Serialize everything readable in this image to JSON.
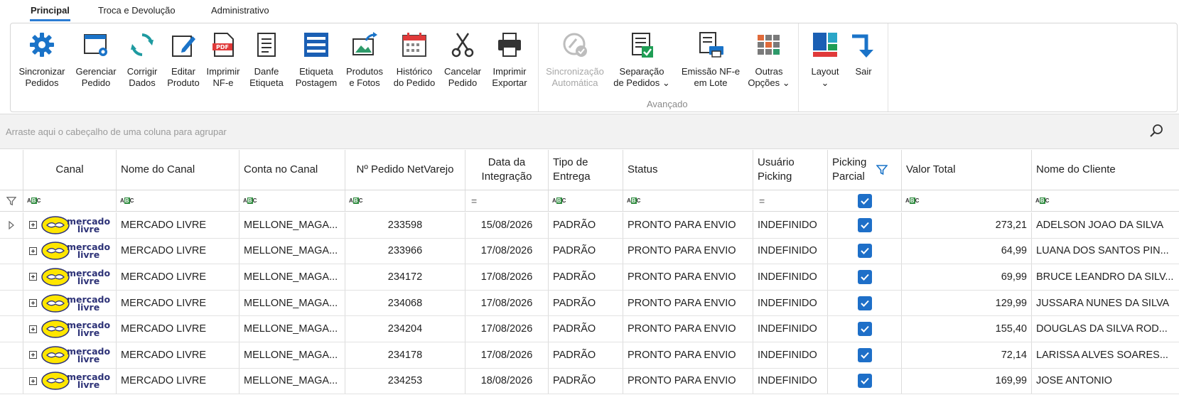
{
  "tabs": [
    {
      "label": "Principal",
      "active": true
    },
    {
      "label": "Troca e Devolução"
    },
    {
      "label": "Administrativo"
    }
  ],
  "ribbon": {
    "buttons": [
      {
        "label": "Sincronizar\nPedidos",
        "icon": "gear-icon"
      },
      {
        "label": "Gerenciar\nPedido",
        "icon": "window-gear-icon"
      },
      {
        "label": "Corrigir\nDados",
        "icon": "refresh-icon"
      },
      {
        "label": "Editar\nProduto",
        "icon": "edit-icon"
      },
      {
        "label": "Imprimir\nNF-e",
        "icon": "pdf-icon"
      },
      {
        "label": "Danfe\nEtiqueta",
        "icon": "document-icon"
      },
      {
        "label": "Etiqueta\nPostagem",
        "icon": "label-icon"
      },
      {
        "label": "Produtos\ne Fotos",
        "icon": "image-share-icon"
      },
      {
        "label": "Histórico\ndo Pedido",
        "icon": "calendar-icon"
      },
      {
        "label": "Cancelar\nPedido",
        "icon": "scissors-icon"
      },
      {
        "label": "Imprimir\nExportar",
        "icon": "printer-icon"
      },
      {
        "label": "Sincronização\nAutomática",
        "icon": "sync-auto-icon",
        "disabled": true
      },
      {
        "label": "Separação\nde Pedidos ⌄",
        "icon": "checklist-icon"
      },
      {
        "label": "Emissão NF-e\nem Lote",
        "icon": "batch-print-icon"
      },
      {
        "label": "Outras\nOpções ⌄",
        "icon": "grid-icon"
      },
      {
        "label": "Layout\n⌄",
        "icon": "layout-icon"
      },
      {
        "label": "Sair",
        "icon": "exit-arrow-icon"
      }
    ],
    "group_caption": "Avançado"
  },
  "group_panel": {
    "hint": "Arraste aqui o cabeçalho de uma coluna para agrupar"
  },
  "grid": {
    "columns": [
      {
        "label": "Canal"
      },
      {
        "label": "Nome do Canal"
      },
      {
        "label": "Conta no Canal"
      },
      {
        "label": "Nº Pedido NetVarejo"
      },
      {
        "label": "Data da\nIntegração"
      },
      {
        "label": "Tipo de\nEntrega"
      },
      {
        "label": "Status"
      },
      {
        "label": "Usuário\nPicking"
      },
      {
        "label": "Picking\nParcial"
      },
      {
        "label": "Valor Total"
      },
      {
        "label": "Nome do Cliente"
      }
    ],
    "filter_row": {
      "abc": "ABC",
      "eq": "="
    },
    "logo_text": "mercado\nlivre",
    "rows": [
      {
        "canal": "MERCADO LIVRE",
        "conta": "MELLONE_MAGA...",
        "pedido": "233598",
        "data": "15/08/2026",
        "tipo": "PADRÃO",
        "status": "PRONTO PARA ENVIO",
        "usuario": "INDEFINIDO",
        "picking": true,
        "valor": "273,21",
        "cliente": "ADELSON JOAO DA SILVA"
      },
      {
        "canal": "MERCADO LIVRE",
        "conta": "MELLONE_MAGA...",
        "pedido": "233966",
        "data": "17/08/2026",
        "tipo": "PADRÃO",
        "status": "PRONTO PARA ENVIO",
        "usuario": "INDEFINIDO",
        "picking": true,
        "valor": "64,99",
        "cliente": "LUANA DOS SANTOS PIN..."
      },
      {
        "canal": "MERCADO LIVRE",
        "conta": "MELLONE_MAGA...",
        "pedido": "234172",
        "data": "17/08/2026",
        "tipo": "PADRÃO",
        "status": "PRONTO PARA ENVIO",
        "usuario": "INDEFINIDO",
        "picking": true,
        "valor": "69,99",
        "cliente": "BRUCE LEANDRO DA SILV..."
      },
      {
        "canal": "MERCADO LIVRE",
        "conta": "MELLONE_MAGA...",
        "pedido": "234068",
        "data": "17/08/2026",
        "tipo": "PADRÃO",
        "status": "PRONTO PARA ENVIO",
        "usuario": "INDEFINIDO",
        "picking": true,
        "valor": "129,99",
        "cliente": "JUSSARA NUNES DA SILVA"
      },
      {
        "canal": "MERCADO LIVRE",
        "conta": "MELLONE_MAGA...",
        "pedido": "234204",
        "data": "17/08/2026",
        "tipo": "PADRÃO",
        "status": "PRONTO PARA ENVIO",
        "usuario": "INDEFINIDO",
        "picking": true,
        "valor": "155,40",
        "cliente": "DOUGLAS DA SILVA ROD..."
      },
      {
        "canal": "MERCADO LIVRE",
        "conta": "MELLONE_MAGA...",
        "pedido": "234178",
        "data": "17/08/2026",
        "tipo": "PADRÃO",
        "status": "PRONTO PARA ENVIO",
        "usuario": "INDEFINIDO",
        "picking": true,
        "valor": "72,14",
        "cliente": "LARISSA ALVES SOARES..."
      },
      {
        "canal": "MERCADO LIVRE",
        "conta": "MELLONE_MAGA...",
        "pedido": "234253",
        "data": "18/08/2026",
        "tipo": "PADRÃO",
        "status": "PRONTO PARA ENVIO",
        "usuario": "INDEFINIDO",
        "picking": true,
        "valor": "169,99",
        "cliente": "JOSE ANTONIO"
      }
    ]
  },
  "colors": {
    "accent": "#2b7cd3",
    "checkbox": "#1e6fc8",
    "logo_yellow": "#ffe600",
    "logo_navy": "#2d3277"
  }
}
